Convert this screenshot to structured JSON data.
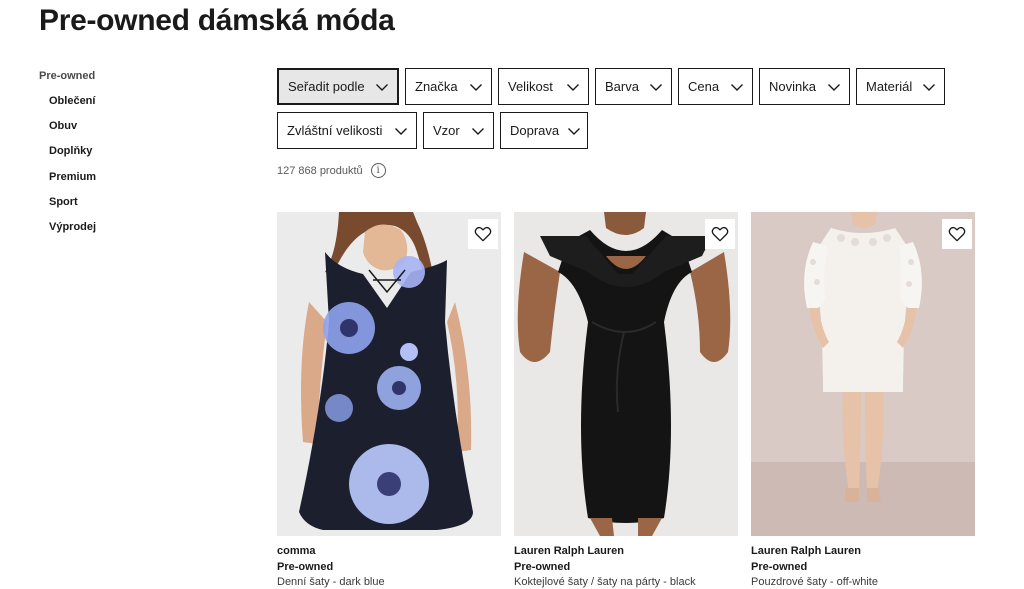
{
  "page": {
    "title": "Pre-owned dámská móda"
  },
  "sidebar": {
    "root": "Pre-owned",
    "items": [
      {
        "label": "Oblečení"
      },
      {
        "label": "Obuv"
      },
      {
        "label": "Doplňky"
      },
      {
        "label": "Premium"
      },
      {
        "label": "Sport"
      },
      {
        "label": "Výprodej"
      }
    ]
  },
  "filters": {
    "row1": [
      {
        "label": "Seřadit podle",
        "active": true
      },
      {
        "label": "Značka"
      },
      {
        "label": "Velikost"
      },
      {
        "label": "Barva"
      },
      {
        "label": "Cena"
      },
      {
        "label": "Novinka"
      },
      {
        "label": "Materiál"
      }
    ],
    "row2": [
      {
        "label": "Zvláštní velikosti"
      },
      {
        "label": "Vzor"
      },
      {
        "label": "Doprava"
      }
    ]
  },
  "results": {
    "count": "127 868 produktů",
    "info_icon": "info-icon"
  },
  "products": [
    {
      "brand": "comma",
      "badge": "Pre-owned",
      "description": "Denní šaty - dark blue",
      "color": "#1c1f2e"
    },
    {
      "brand": "Lauren Ralph Lauren",
      "badge": "Pre-owned",
      "description": "Koktejlové šaty / šaty na párty - black",
      "color": "#141414"
    },
    {
      "brand": "Lauren Ralph Lauren",
      "badge": "Pre-owned",
      "description": "Pouzdrové šaty - off-white",
      "color": "#f4f1ec"
    }
  ],
  "colors": {
    "text": "#1a1a1a",
    "border": "#1a1a1a",
    "active_bg": "#e7e7e7",
    "muted": "#5a5a5a"
  }
}
